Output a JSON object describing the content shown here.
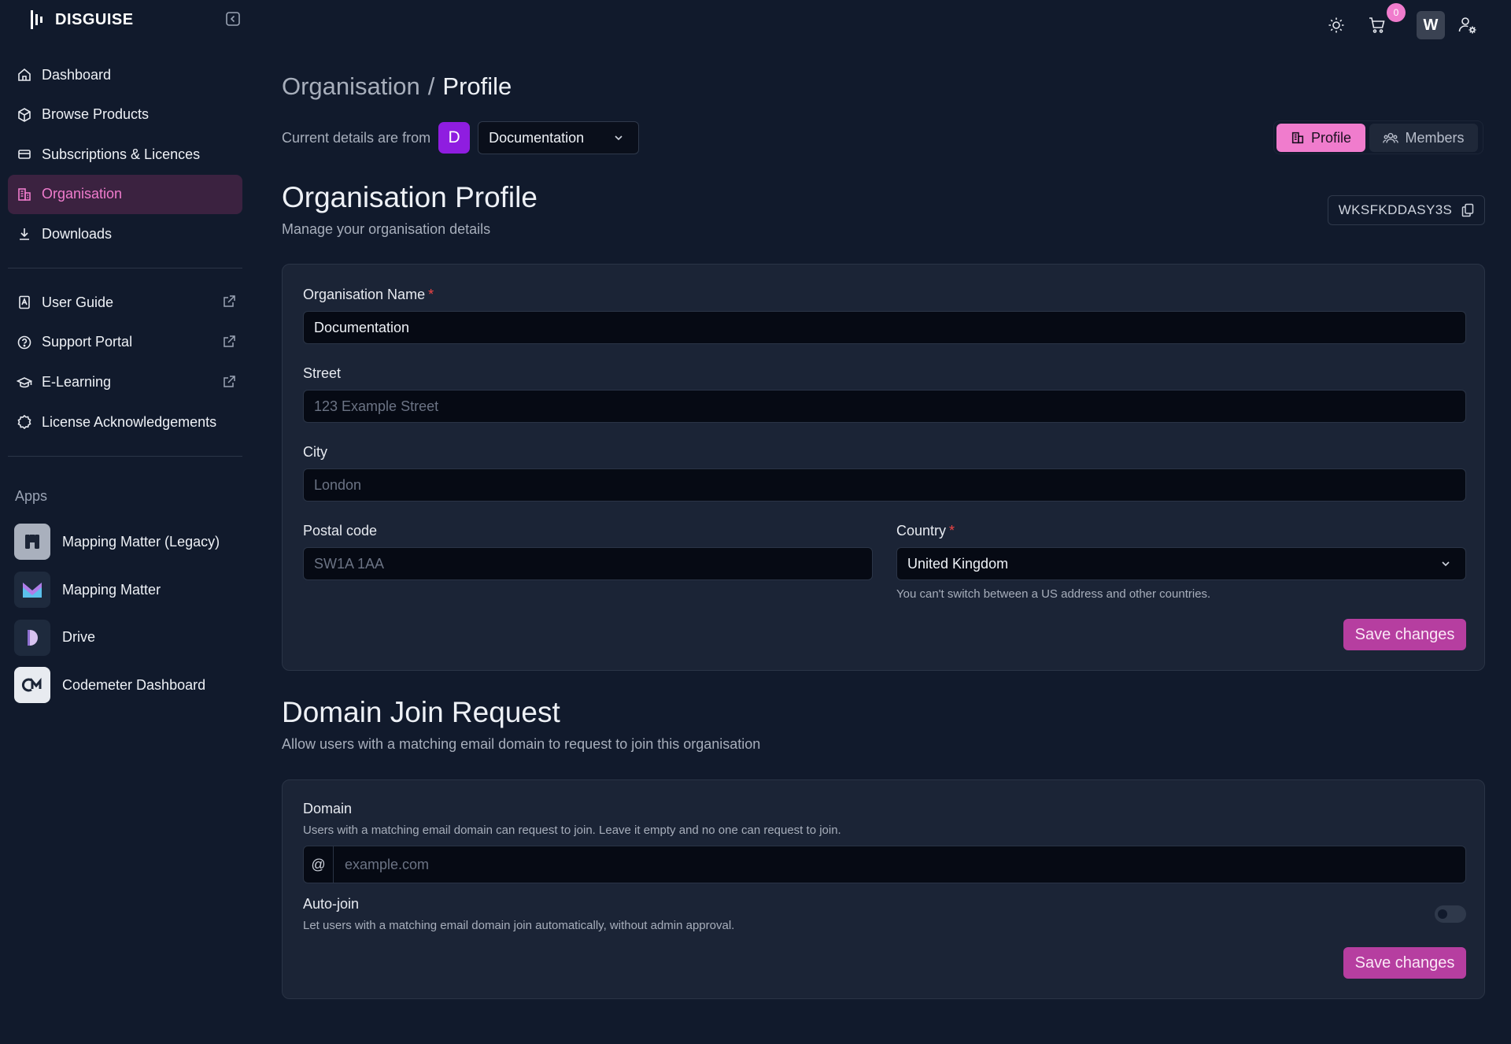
{
  "brand": {
    "name": "DISGUISE"
  },
  "sidebar": {
    "main_items": [
      {
        "label": "Dashboard",
        "icon": "home-icon"
      },
      {
        "label": "Browse Products",
        "icon": "package-icon"
      },
      {
        "label": "Subscriptions & Licences",
        "icon": "card-icon"
      },
      {
        "label": "Organisation",
        "icon": "building-icon",
        "active": true
      },
      {
        "label": "Downloads",
        "icon": "download-icon"
      }
    ],
    "resource_items": [
      {
        "label": "User Guide",
        "icon": "book-icon",
        "external": true
      },
      {
        "label": "Support Portal",
        "icon": "help-circle-icon",
        "external": true
      },
      {
        "label": "E-Learning",
        "icon": "graduation-cap-icon",
        "external": true
      },
      {
        "label": "License Acknowledgements",
        "icon": "badge-icon"
      }
    ],
    "apps_label": "Apps",
    "apps": [
      {
        "label": "Mapping Matter (Legacy)"
      },
      {
        "label": "Mapping Matter"
      },
      {
        "label": "Drive"
      },
      {
        "label": "Codemeter Dashboard"
      }
    ]
  },
  "topbar": {
    "cart_count": "0",
    "avatar_initial": "W"
  },
  "breadcrumb": {
    "parent": "Organisation",
    "separator": "/",
    "current": "Profile"
  },
  "org_switch": {
    "label": "Current details are from",
    "badge": "D",
    "selected": "Documentation"
  },
  "tabs": {
    "profile": "Profile",
    "members": "Members"
  },
  "profile": {
    "title": "Organisation Profile",
    "subtitle": "Manage your organisation details",
    "org_id": "WKSFKDDASY3S",
    "fields": {
      "name_label": "Organisation Name",
      "name_value": "Documentation",
      "street_label": "Street",
      "street_placeholder": "123 Example Street",
      "city_label": "City",
      "city_placeholder": "London",
      "postal_label": "Postal code",
      "postal_placeholder": "SW1A 1AA",
      "country_label": "Country",
      "country_value": "United Kingdom",
      "country_hint": "You can't switch between a US address and other countries.",
      "required_mark": "*"
    },
    "save_label": "Save changes"
  },
  "domain": {
    "title": "Domain Join Request",
    "subtitle": "Allow users with a matching email domain to request to join this organisation",
    "domain_label": "Domain",
    "domain_hint": "Users with a matching email domain can request to join. Leave it empty and no one can request to join.",
    "prefix": "@",
    "domain_placeholder": "example.com",
    "autojoin_label": "Auto-join",
    "autojoin_hint": "Let users with a matching email domain join automatically, without admin approval.",
    "autojoin_enabled": false,
    "save_label": "Save changes"
  },
  "colors": {
    "accent": "#f07ccd",
    "save_button": "#b63ea0",
    "background": "#111a2c",
    "card": "#1b2436"
  }
}
